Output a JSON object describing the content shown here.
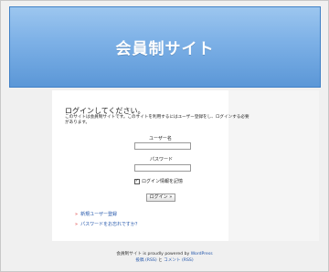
{
  "header": {
    "title": "会員制サイト"
  },
  "login": {
    "heading": "ログインしてください。",
    "description": "このサイトは会員制サイトです。このサイトを利用するにはユーザー登録をし、ログインする必要があります。",
    "username_label": "ユーザー名",
    "password_label": "パスワード",
    "remember_label": "ログイン情報を記憶",
    "remember_checked": true,
    "submit_label": "ログイン »"
  },
  "links": [
    {
      "bullet": "»",
      "label": "新規ユーザー登録"
    },
    {
      "bullet": "»",
      "label": "パスワードをお忘れですか？"
    }
  ],
  "footer": {
    "site_name": "会員制サイト",
    "powered_text": "is proudly powered by",
    "wordpress": "WordPress",
    "entries_rss": "投稿 (RSS)",
    "and": "と",
    "comments_rss": "コメント (RSS)"
  },
  "colors": {
    "header_top": "#9cc6ef",
    "header_bottom": "#5b97d7",
    "link": "#2255aa",
    "bullet": "#d33333"
  }
}
